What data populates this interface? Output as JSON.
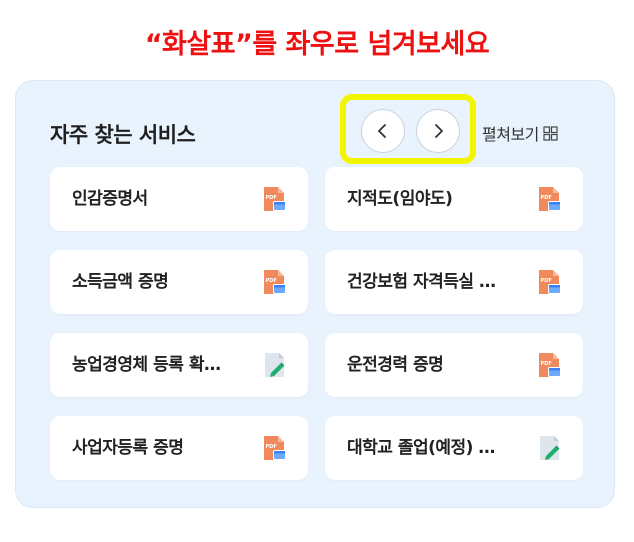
{
  "instruction": "“화살표”를 좌우로 넘겨보세요",
  "panel": {
    "title": "자주 찾는 서비스",
    "expand_label": "펼쳐보기"
  },
  "services": [
    {
      "label": "인감증명서",
      "icon": "pdf-document-icon"
    },
    {
      "label": "지적도(임야도)",
      "icon": "pdf-document-icon"
    },
    {
      "label": "소득금액 증명",
      "icon": "pdf-document-icon"
    },
    {
      "label": "건강보험 자격득실 …",
      "icon": "pdf-document-icon"
    },
    {
      "label": "농업경영체 등록 확…",
      "icon": "edit-document-icon"
    },
    {
      "label": "운전경력 증명",
      "icon": "pdf-document-icon"
    },
    {
      "label": "사업자등록 증명",
      "icon": "pdf-document-icon"
    },
    {
      "label": "대학교 졸업(예정) …",
      "icon": "edit-document-icon"
    }
  ],
  "colors": {
    "instruction": "#ee1111",
    "panel_bg": "#e8f3fe",
    "highlight": "#f2f500",
    "pdf_orange": "#f08a5d",
    "edit_green": "#1fae6b"
  }
}
